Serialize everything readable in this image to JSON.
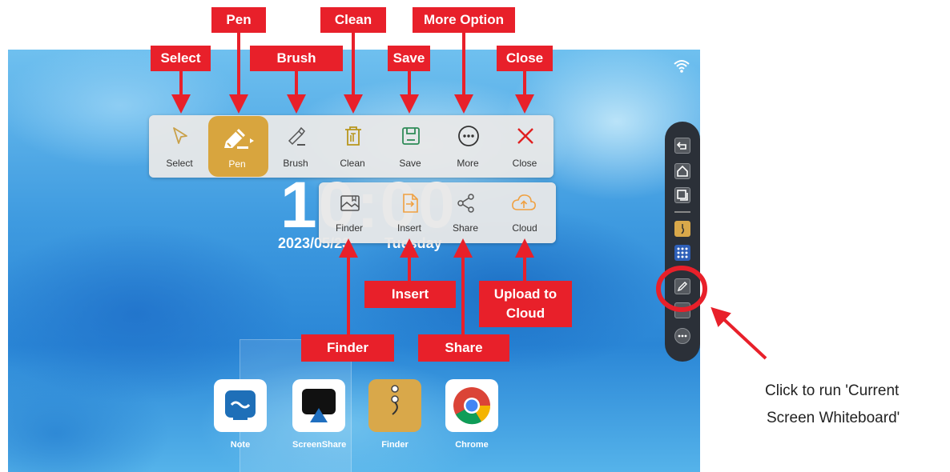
{
  "toolbar_main": {
    "select_label": "Select",
    "pen_label": "Pen",
    "brush_label": "Brush",
    "clean_label": "Clean",
    "save_label": "Save",
    "more_label": "More",
    "close_label": "Close"
  },
  "toolbar_more": {
    "finder_label": "Finder",
    "insert_label": "Insert",
    "share_label": "Share",
    "cloud_label": "Cloud"
  },
  "desktop": {
    "clock": "10:00",
    "date": "2023/05/23",
    "weekday": "Tuesday"
  },
  "apps": [
    {
      "label": "Note"
    },
    {
      "label": "ScreenShare"
    },
    {
      "label": "Finder"
    },
    {
      "label": "Chrome"
    }
  ],
  "annotations": {
    "select": "Select",
    "pen": "Pen",
    "brush": "Brush",
    "clean": "Clean",
    "save": "Save",
    "more_option": "More Option",
    "close": "Close",
    "insert": "Insert",
    "upload_line1": "Upload to",
    "upload_line2": "Cloud",
    "finder": "Finder",
    "share": "Share",
    "caption_line1": "Click to run 'Current",
    "caption_line2": "Screen Whiteboard'"
  },
  "colors": {
    "annotation_red": "#e8202a",
    "pen_active": "#d8a53e",
    "close_x": "#e02020",
    "clean_icon": "#b8961c",
    "save_icon": "#2e8b57",
    "cloud_icon": "#f0a040"
  },
  "icons": {
    "select": "cursor-arrow-icon",
    "pen": "pen-icon",
    "brush": "brush-icon",
    "clean": "trash-icon",
    "save": "floppy-icon",
    "more": "ellipsis-circle-icon",
    "close": "x-icon",
    "finder": "image-folder-icon",
    "insert": "file-insert-icon",
    "share": "share-icon",
    "cloud": "cloud-upload-icon"
  }
}
